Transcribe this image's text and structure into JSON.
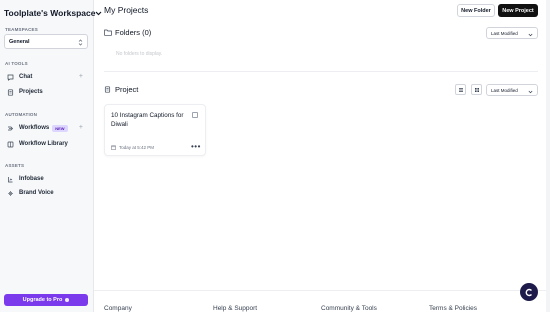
{
  "workspace": {
    "name": "Toolplate's Workspace"
  },
  "sidebar": {
    "teamspaces_label": "TEAMSPACES",
    "teamspace_selected": "General",
    "ai_tools_label": "AI TOOLS",
    "ai_tools": [
      {
        "label": "Chat",
        "icon": "chat-icon",
        "has_add": true
      },
      {
        "label": "Projects",
        "icon": "projects-icon",
        "has_add": false
      }
    ],
    "automation_label": "AUTOMATION",
    "automation": [
      {
        "label": "Workflows",
        "badge": "NEW",
        "icon": "workflows-icon",
        "has_add": true
      },
      {
        "label": "Workflow Library",
        "icon": "library-icon",
        "has_add": false
      }
    ],
    "assets_label": "ASSETS",
    "assets": [
      {
        "label": "Infobase",
        "icon": "infobase-icon"
      },
      {
        "label": "Brand Voice",
        "icon": "brand-voice-icon"
      }
    ],
    "upgrade_label": "Upgrade to Pro"
  },
  "main": {
    "title": "My Projects",
    "new_folder_label": "New Folder",
    "new_project_label": "New Project",
    "folders": {
      "title": "Folders (0)",
      "sort_label": "Last Modified",
      "empty_message": "No folders to display."
    },
    "project": {
      "title": "Project",
      "sort_label": "Last Modified",
      "cards": [
        {
          "title": "10 Instagram Captions for Diwali",
          "date": "Today at 5:42 PM"
        }
      ]
    }
  },
  "footer": {
    "links": [
      "Company",
      "Help & Support",
      "Community & Tools",
      "Terms & Policies"
    ]
  },
  "colors": {
    "accent": "#7c3aed",
    "dark_button": "#111111",
    "chat_bubble": "#1e1b4b",
    "sidebar_bg": "#f7f8fa"
  }
}
